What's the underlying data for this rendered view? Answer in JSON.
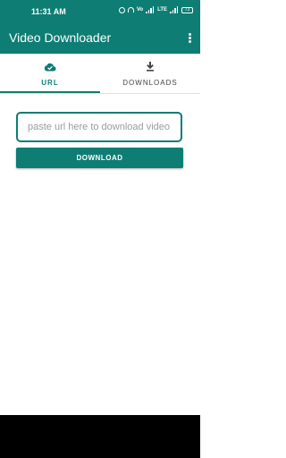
{
  "status_bar": {
    "time": "11:31 AM",
    "network_badges": [
      "Vo",
      "LTE"
    ],
    "battery": "73"
  },
  "app_bar": {
    "title": "Video Downloader",
    "menu_icon": "overflow-menu-icon"
  },
  "tabs": [
    {
      "label": "URL",
      "icon": "cloud-check-icon",
      "selected": true
    },
    {
      "label": "DOWNLOADS",
      "icon": "download-icon",
      "selected": false
    }
  ],
  "main": {
    "url_input": {
      "value": "",
      "placeholder": "paste url here to download video"
    },
    "download_button_label": "DOWNLOAD"
  },
  "colors": {
    "primary": "#0e7d74",
    "background": "#ffffff",
    "nav_bar": "#000000"
  }
}
